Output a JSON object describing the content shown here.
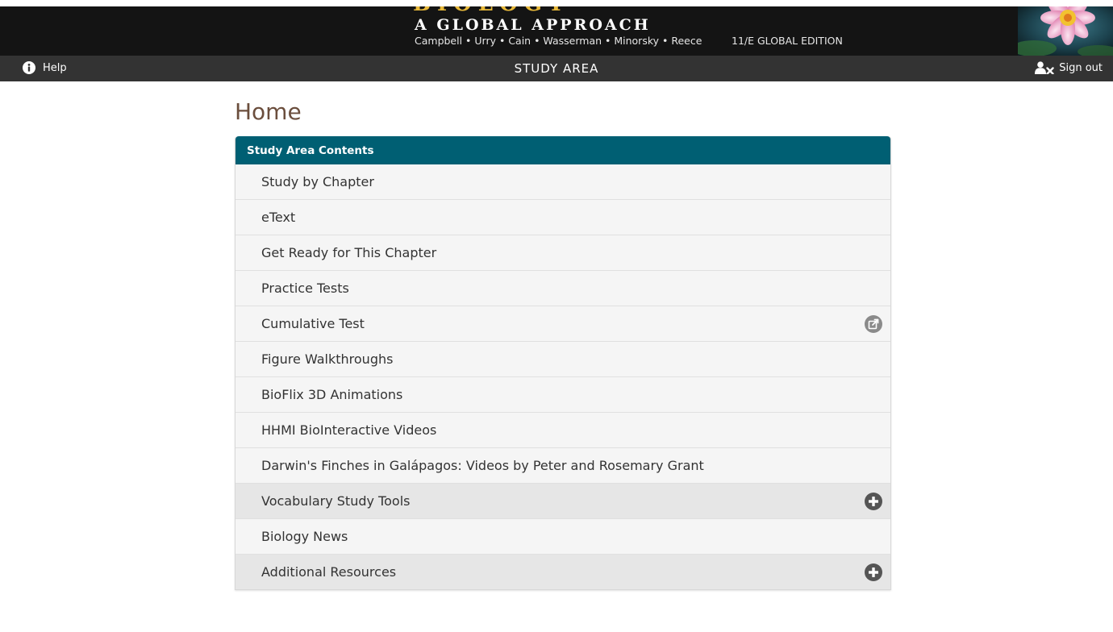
{
  "banner": {
    "big_title": "BIOLOGY",
    "subtitle": "A GLOBAL APPROACH",
    "authors": "Campbell • Urry • Cain • Wasserman • Minorsky • Reece",
    "edition": "11/E GLOBAL EDITION"
  },
  "navbar": {
    "help_label": "Help",
    "help_icon": "info-circle-icon",
    "title": "STUDY AREA",
    "signout_label": "Sign out",
    "signout_icon": "user-remove-icon"
  },
  "page": {
    "title": "Home"
  },
  "panel": {
    "header": "Study Area Contents",
    "items": [
      {
        "label": "Study by Chapter"
      },
      {
        "label": "eText"
      },
      {
        "label": "Get Ready for This Chapter"
      },
      {
        "label": "Practice Tests"
      },
      {
        "label": "Cumulative Test",
        "icon": "external-link-icon"
      },
      {
        "label": "Figure Walkthroughs"
      },
      {
        "label": "BioFlix 3D Animations"
      },
      {
        "label": "HHMI BioInteractive Videos"
      },
      {
        "label": "Darwin's Finches in Galápagos: Videos by Peter and Rosemary Grant"
      },
      {
        "label": "Vocabulary Study Tools",
        "icon": "plus-circle-icon"
      },
      {
        "label": "Biology News"
      },
      {
        "label": "Additional Resources",
        "icon": "plus-circle-icon"
      }
    ]
  },
  "colors": {
    "banner_bg": "#141414",
    "navbar_bg": "#333333",
    "panel_header_bg": "#005f73",
    "title_color": "#6b4e3d",
    "item_bg": "#f5f5f5",
    "expandable_item_bg": "#e6e6e6",
    "icon_gray": "#8a8a8a"
  }
}
